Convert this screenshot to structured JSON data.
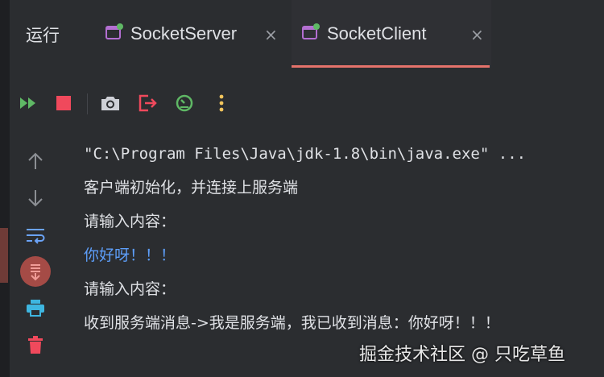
{
  "run_panel": {
    "title": "运行",
    "tabs": [
      {
        "label": "SocketServer",
        "close_glyph": "×",
        "active": false,
        "icon": "run-config-icon"
      },
      {
        "label": "SocketClient",
        "close_glyph": "×",
        "active": true,
        "icon": "run-config-icon"
      }
    ]
  },
  "toolbar": {
    "icons": [
      "rerun-icon",
      "stop-icon",
      "screenshot-icon",
      "exit-icon",
      "profiler-icon",
      "more-icon"
    ]
  },
  "sidebar": {
    "icons": [
      "up-arrow-icon",
      "down-arrow-icon",
      "soft-wrap-icon",
      "scroll-to-end-icon",
      "print-icon",
      "delete-icon"
    ]
  },
  "console": {
    "lines": [
      "\"C:\\Program Files\\Java\\jdk-1.8\\bin\\java.exe\" ...",
      "客户端初始化，并连接上服务端",
      "请输入内容：",
      "你好呀！！！",
      "请输入内容：",
      "收到服务端消息->我是服务端，我已收到消息：你好呀！！！"
    ]
  },
  "watermark": "掘金技术社区 @ 只吃草鱼",
  "colors": {
    "background": "#2b2d30",
    "accent_underline": "#e5726b",
    "input_text": "#5d9ef9",
    "rerun_green": "#5fb865",
    "stop_red": "#f0495c"
  }
}
